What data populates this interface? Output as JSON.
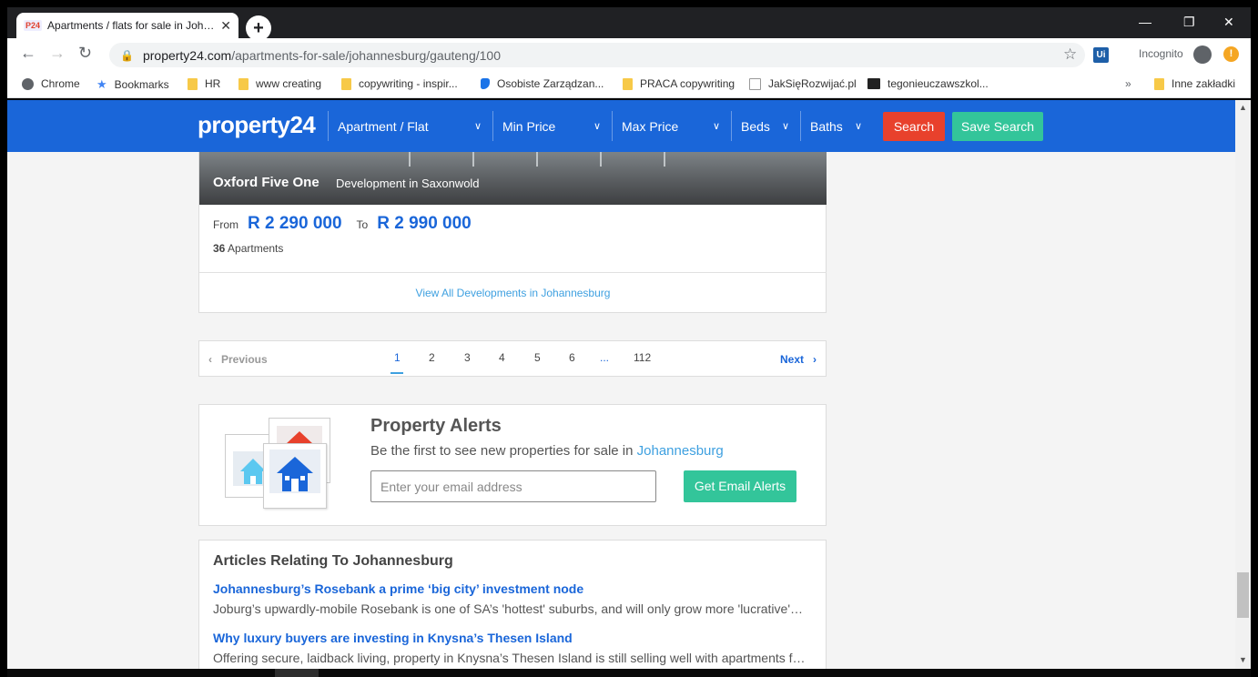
{
  "browser": {
    "tab_title": "Apartments / flats for sale in Joh…",
    "tab_favicon": "P24",
    "tab_close": "✕",
    "new_tab": "+",
    "url_host": "property24.com",
    "url_path": "/apartments-for-sale/johannesburg/gauteng/100",
    "incognito_label": "Incognito",
    "ext_label": "Ui",
    "more_bookmarks": "»",
    "bookmarks": [
      {
        "label": "Chrome"
      },
      {
        "label": "Bookmarks"
      },
      {
        "label": "HR"
      },
      {
        "label": "www creating"
      },
      {
        "label": "copywriting - inspir..."
      },
      {
        "label": "Osobiste Zarządzan..."
      },
      {
        "label": "PRACA copywriting"
      },
      {
        "label": "JakSięRozwijać.pl"
      },
      {
        "label": "tegonieuczawszkol..."
      },
      {
        "label": "Inne zakładki"
      }
    ]
  },
  "header": {
    "logo": "property24",
    "filters": [
      {
        "label": "Apartment / Flat"
      },
      {
        "label": "Min Price"
      },
      {
        "label": "Max Price"
      },
      {
        "label": "Beds"
      },
      {
        "label": "Baths"
      }
    ],
    "search_label": "Search",
    "save_search_label": "Save Search"
  },
  "development": {
    "name": "Oxford Five One",
    "subtitle": "Development in Saxonwold",
    "from_label": "From",
    "from_price": "R 2 290 000",
    "to_label": "To",
    "to_price": "R 2 990 000",
    "apartments_count": "36",
    "apartments_label": "Apartments",
    "view_all": "View All Developments in Johannesburg"
  },
  "pagination": {
    "previous": "Previous",
    "next": "Next",
    "pages": [
      "1",
      "2",
      "3",
      "4",
      "5",
      "6",
      "...",
      "112"
    ],
    "current": "1"
  },
  "alerts": {
    "title": "Property Alerts",
    "subtitle": "Be the first to see new properties for sale in",
    "city": "Johannesburg",
    "email_placeholder": "Enter your email address",
    "button": "Get Email Alerts"
  },
  "articles": {
    "heading": "Articles Relating To Johannesburg",
    "items": [
      {
        "title": "Johannesburg’s Rosebank a prime ‘big city’ investment node",
        "desc": "Joburg’s upwardly-mobile Rosebank is one of SA’s 'hottest' suburbs, and will only grow more 'lucrative'…"
      },
      {
        "title": "Why luxury buyers are investing in Knysna’s Thesen Island",
        "desc": "Offering secure, laidback living, property in Knysna’s Thesen Island is still selling well with apartments f…"
      }
    ]
  },
  "colors": {
    "brand_blue": "#1a66d9",
    "search_red": "#e8412c",
    "save_green": "#33c59a",
    "link_light_blue": "#3ea0e0"
  }
}
